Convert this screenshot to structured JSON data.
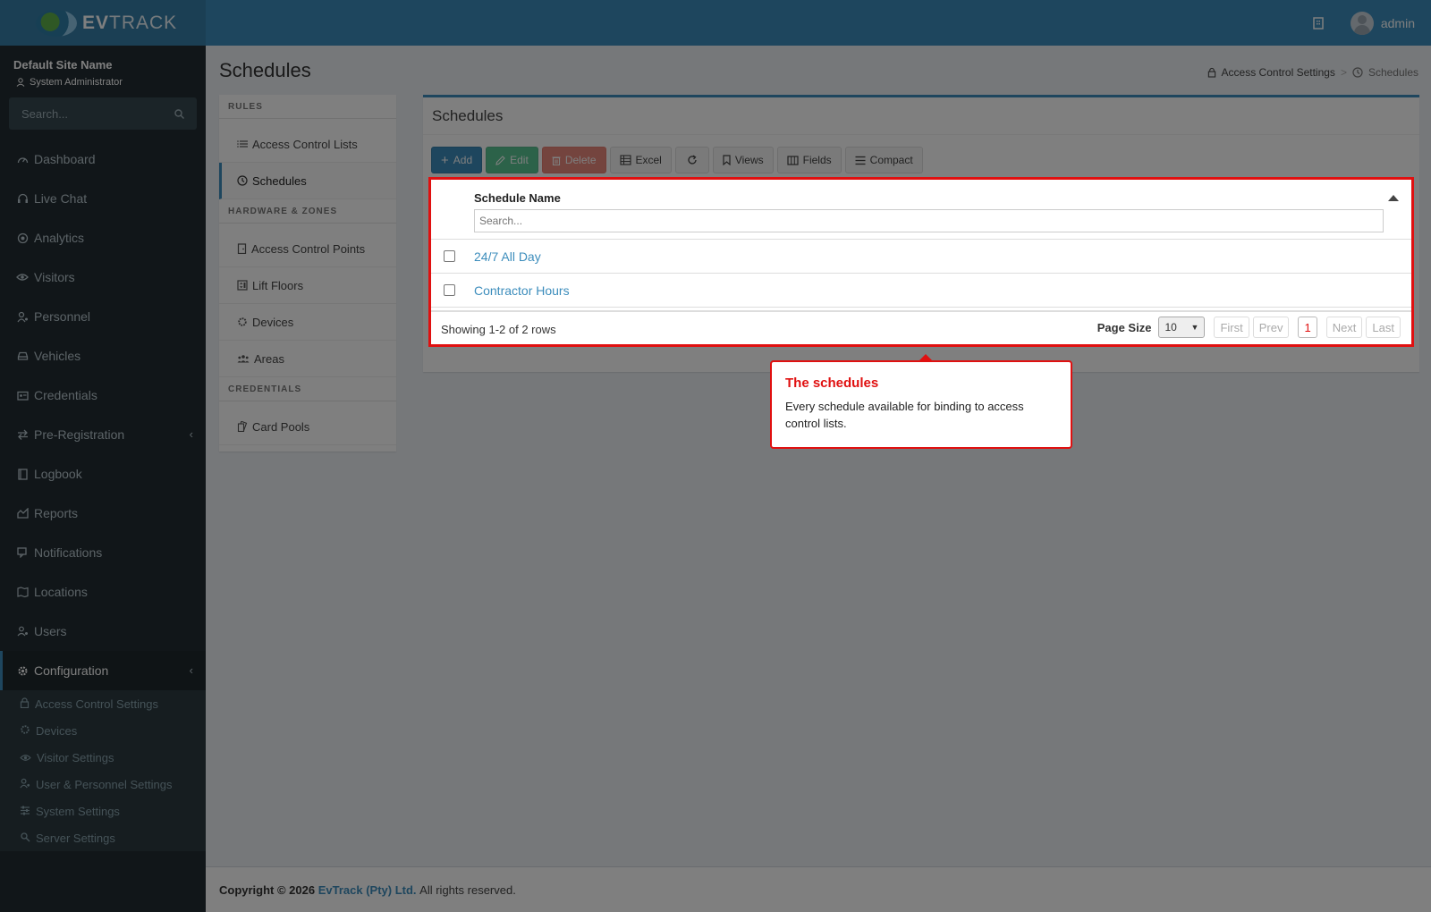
{
  "header": {
    "logo_text_bold": "EV",
    "logo_text_rest": "TRACK",
    "user_name": "admin"
  },
  "sidebar": {
    "site_name": "Default Site Name",
    "role": "System Administrator",
    "search_placeholder": "Search...",
    "items": [
      {
        "label": "Dashboard",
        "icon": "dashboard-icon"
      },
      {
        "label": "Live Chat",
        "icon": "headset-icon"
      },
      {
        "label": "Analytics",
        "icon": "target-icon"
      },
      {
        "label": "Visitors",
        "icon": "eye-icon"
      },
      {
        "label": "Personnel",
        "icon": "user-gear-icon"
      },
      {
        "label": "Vehicles",
        "icon": "car-icon"
      },
      {
        "label": "Credentials",
        "icon": "id-card-icon"
      },
      {
        "label": "Pre-Registration",
        "icon": "arrows-icon"
      },
      {
        "label": "Logbook",
        "icon": "book-icon"
      },
      {
        "label": "Reports",
        "icon": "chart-icon"
      },
      {
        "label": "Notifications",
        "icon": "chat-icon"
      },
      {
        "label": "Locations",
        "icon": "map-icon"
      },
      {
        "label": "Users",
        "icon": "users-icon"
      },
      {
        "label": "Configuration",
        "icon": "gear-icon"
      }
    ],
    "sub_items": [
      {
        "label": "Access Control Settings",
        "icon": "lock-icon"
      },
      {
        "label": "Devices",
        "icon": "cog-icon"
      },
      {
        "label": "Visitor Settings",
        "icon": "eye-icon"
      },
      {
        "label": "User & Personnel Settings",
        "icon": "user-gear-icon"
      },
      {
        "label": "System Settings",
        "icon": "sliders-icon"
      },
      {
        "label": "Server Settings",
        "icon": "server-icon"
      }
    ]
  },
  "page": {
    "title": "Schedules",
    "breadcrumb": [
      "Access Control Settings",
      "Schedules"
    ]
  },
  "rules_panel": {
    "section_rules": "RULES",
    "rules_items": [
      "Access Control Lists",
      "Schedules"
    ],
    "section_hardware": "HARDWARE & ZONES",
    "hardware_items": [
      "Access Control Points",
      "Lift Floors",
      "Devices",
      "Areas"
    ],
    "section_credentials": "CREDENTIALS",
    "credential_items": [
      "Card Pools"
    ]
  },
  "main": {
    "box_title": "Schedules",
    "toolbar": {
      "add": "Add",
      "edit": "Edit",
      "delete": "Delete",
      "excel": "Excel",
      "views": "Views",
      "fields": "Fields",
      "compact": "Compact"
    },
    "table": {
      "column": "Schedule Name",
      "filter_placeholder": "Search...",
      "rows": [
        "24/7 All Day",
        "Contractor Hours"
      ],
      "showing": "Showing 1-2 of 2 rows",
      "page_size_label": "Page Size",
      "page_size": "10",
      "first": "First",
      "prev": "Prev",
      "current_page": "1",
      "next": "Next",
      "last": "Last"
    }
  },
  "tooltip": {
    "title": "The schedules",
    "body": "Every schedule available for binding to access control lists."
  },
  "footer": {
    "copyright": "Copyright © 2026",
    "company": "EvTrack (Pty) Ltd.",
    "rights": "All rights reserved."
  },
  "colors": {
    "brand": "#3c8dbc",
    "highlight": "#e01010",
    "sidebar": "#222d32"
  }
}
